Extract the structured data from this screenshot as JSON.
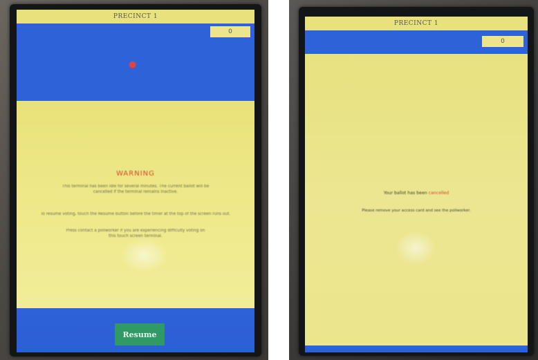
{
  "left_screen": {
    "header": "PRECINCT 1",
    "counter": "0",
    "warning_title": "WARNING",
    "warning_body": "This terminal has been idle for several minutes. The current ballot will be cancelled if the terminal remains inactive.",
    "complete_line": "To resume voting, touch the Resume button before the timer at the top of the screen runs out.",
    "press_line": "Press contact a pollworker if you are experiencing difficulty voting on this touch screen terminal.",
    "resume_label": "Resume"
  },
  "right_screen": {
    "header": "PRECINCT 1",
    "counter": "0",
    "cancel_prefix": "Your ballot has been",
    "cancel_status": "cancelled",
    "remove_line": "Please remove your access card and see the pollworker."
  },
  "colors": {
    "blue": "#2e62d8",
    "yellow": "#e8e27a",
    "warning_red": "#d3462a",
    "button_green": "#2f9a66"
  }
}
